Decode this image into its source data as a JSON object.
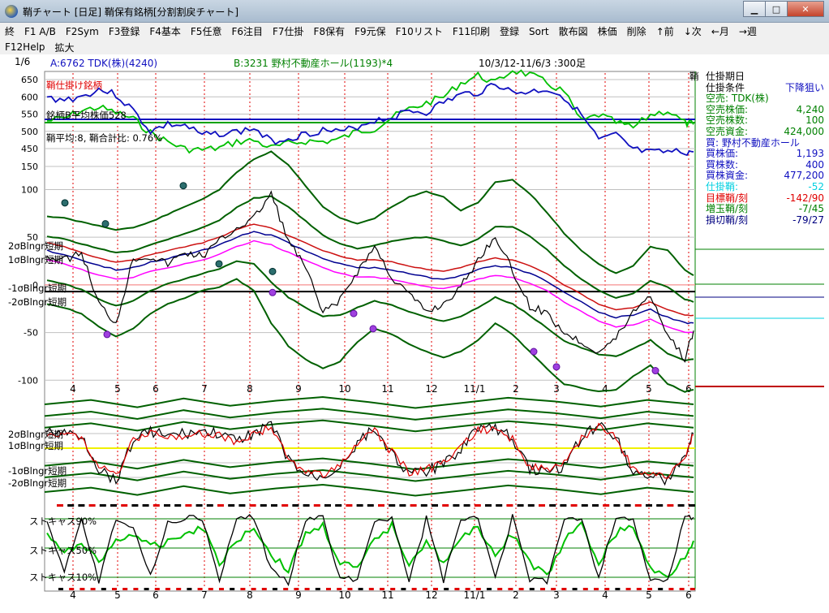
{
  "window": {
    "title": "鞘チャート  [日足]  鞘保有銘柄[分割割戻チャート]"
  },
  "menu": [
    "終",
    "F1 A/B",
    "F2Sym",
    "F3登録",
    "F4基本",
    "F5任意",
    "F6注目",
    "F7仕掛",
    "F8保有",
    "F9元保",
    "F10リスト",
    "F11印刷",
    "登録",
    "Sort",
    "散布図",
    "株価",
    "削除",
    "↑前",
    "↓次",
    "←月",
    "→週"
  ],
  "menu2": [
    "F12Help",
    "拡大"
  ],
  "info": {
    "page": "1/6",
    "stock_a": "A:6762 TDK(株)(4240)",
    "stock_b": "B:3231 野村不動産ホール(1193)*4",
    "period": "10/3/12-11/6/3 :300足"
  },
  "overlays": {
    "top_title": "鞘仕掛け銘柄",
    "avg_b": "銘柄B平均株価528",
    "avg_ratio": "鞘平均:8, 鞘合計比: 0.76%",
    "corner": "鞘"
  },
  "band_labels": {
    "p2": "2σBlngr短期",
    "p1": "1σBlngr短期",
    "m1": "-1σBlngr短期",
    "m2": "-2σBlngr短期"
  },
  "stoch_labels": {
    "s90": "ストキャス90%",
    "s50": "ストキャス50%",
    "s10": "ストキャス10%"
  },
  "x_months": [
    "4",
    "5",
    "6",
    "7",
    "8",
    "9",
    "10",
    "11",
    "12",
    "11/1",
    "2",
    "3",
    "4",
    "5",
    "6"
  ],
  "colors": {
    "stock_a": "#1010c0",
    "stock_b": "#00c000",
    "band": "#006000",
    "spread": "#000000",
    "ma_red": "#cc1010",
    "ma_pink": "#ff00ff",
    "ma_blue": "#000090",
    "zero_line": "#ff8080"
  },
  "chart_data": [
    {
      "type": "line",
      "name": "price",
      "yticks": [
        "650",
        "600",
        "550",
        "500",
        "450",
        "150"
      ],
      "ylim": [
        100,
        680
      ],
      "x": [
        0,
        8,
        16,
        24,
        32,
        40,
        48,
        56,
        64,
        72,
        80,
        88,
        96,
        104,
        112,
        120,
        128,
        136,
        144,
        152,
        160,
        168,
        176,
        184,
        192,
        200,
        208,
        216,
        224,
        232,
        240,
        248,
        256,
        264,
        272,
        280,
        288,
        296,
        300
      ],
      "series": [
        {
          "name": "A",
          "values": [
            596,
            592,
            600,
            622,
            606,
            560,
            500,
            520,
            516,
            488,
            494,
            498,
            508,
            470,
            480,
            492,
            504,
            496,
            514,
            532,
            540,
            560,
            555,
            584,
            606,
            612,
            640,
            612,
            614,
            622,
            600,
            546,
            474,
            488,
            432,
            376,
            390,
            384,
            396
          ]
        },
        {
          "name": "B",
          "values": [
            530,
            538,
            560,
            570,
            554,
            536,
            496,
            470,
            444,
            430,
            452,
            470,
            474,
            452,
            464,
            472,
            470,
            478,
            500,
            508,
            540,
            564,
            582,
            600,
            640,
            662,
            640,
            678,
            664,
            640,
            614,
            528,
            548,
            526,
            510,
            548,
            560,
            524,
            520
          ]
        }
      ]
    },
    {
      "type": "line",
      "name": "spread",
      "yticks": [
        "100",
        "50",
        "0",
        "-50",
        "-100"
      ],
      "ylim": [
        -110,
        120
      ],
      "x": [
        0,
        8,
        16,
        24,
        32,
        40,
        48,
        56,
        64,
        72,
        80,
        88,
        96,
        104,
        112,
        120,
        128,
        136,
        144,
        152,
        160,
        168,
        176,
        184,
        192,
        200,
        208,
        216,
        224,
        232,
        240,
        248,
        256,
        264,
        272,
        280,
        288,
        296,
        300
      ],
      "series": [
        {
          "name": "spread",
          "values": [
            30,
            26,
            34,
            -20,
            -40,
            28,
            30,
            22,
            34,
            30,
            46,
            60,
            70,
            96,
            46,
            18,
            -30,
            -16,
            14,
            40,
            8,
            -10,
            -28,
            -20,
            -2,
            26,
            52,
            14,
            -22,
            -30,
            -50,
            -60,
            -70,
            -56,
            -28,
            -10,
            -52,
            -78,
            -48
          ]
        },
        {
          "name": "ma",
          "values": [
            30,
            26,
            20,
            14,
            10,
            12,
            18,
            22,
            26,
            30,
            36,
            44,
            50,
            46,
            38,
            30,
            22,
            16,
            12,
            12,
            10,
            6,
            2,
            0,
            4,
            10,
            14,
            12,
            6,
            -2,
            -14,
            -24,
            -34,
            -40,
            -38,
            -32,
            -40,
            -46,
            -46
          ]
        },
        {
          "name": "upper2",
          "values": [
            72,
            70,
            66,
            62,
            58,
            60,
            66,
            74,
            82,
            90,
            100,
            118,
            132,
            140,
            126,
            104,
            82,
            70,
            64,
            70,
            82,
            92,
            98,
            92,
            78,
            86,
            108,
            110,
            96,
            76,
            54,
            36,
            22,
            12,
            20,
            40,
            36,
            16,
            10
          ]
        },
        {
          "name": "lower2",
          "values": [
            -20,
            -24,
            -30,
            -44,
            -54,
            -46,
            -30,
            -20,
            -14,
            -6,
            -2,
            6,
            -6,
            -40,
            -64,
            -78,
            -88,
            -80,
            -60,
            -46,
            -52,
            -62,
            -70,
            -76,
            -70,
            -58,
            -40,
            -52,
            -70,
            -88,
            -104,
            -108,
            -112,
            -110,
            -96,
            -84,
            -104,
            -112,
            -110
          ]
        }
      ]
    },
    {
      "type": "line",
      "name": "spread_norm",
      "x": [
        0,
        8,
        16,
        24,
        32,
        40,
        48,
        56,
        64,
        72,
        80,
        88,
        96,
        104,
        112,
        120,
        128,
        136,
        144,
        152,
        160,
        168,
        176,
        184,
        192,
        200,
        208,
        216,
        224,
        232,
        240,
        248,
        256,
        264,
        272,
        280,
        288,
        296,
        300
      ],
      "series": [
        {
          "name": "norm",
          "values": [
            1.2,
            1.0,
            0.9,
            -1.4,
            -2.2,
            0.6,
            1.2,
            0.8,
            1.0,
            1.1,
            1.0,
            0.4,
            1.1,
            1.6,
            -0.8,
            -1.9,
            -2.0,
            -1.2,
            0.4,
            1.3,
            -0.3,
            -1.8,
            -1.6,
            -1.1,
            0.0,
            1.5,
            1.3,
            0.7,
            -1.4,
            -1.7,
            -1.2,
            0.8,
            1.6,
            0.9,
            -1.7,
            -1.8,
            -2.2,
            -0.6,
            1.0
          ]
        }
      ]
    },
    {
      "type": "line",
      "name": "stochastic",
      "x": [
        0,
        8,
        16,
        24,
        32,
        40,
        48,
        56,
        64,
        72,
        80,
        88,
        96,
        104,
        112,
        120,
        128,
        136,
        144,
        152,
        160,
        168,
        176,
        184,
        192,
        200,
        208,
        216,
        224,
        232,
        240,
        248,
        256,
        264,
        272,
        280,
        288,
        296,
        300
      ],
      "series": [
        {
          "name": "fast",
          "values": [
            88,
            20,
            92,
            5,
            92,
            80,
            10,
            85,
            92,
            90,
            4,
            92,
            92,
            20,
            4,
            90,
            90,
            8,
            8,
            88,
            92,
            4,
            90,
            6,
            88,
            90,
            10,
            92,
            6,
            4,
            92,
            90,
            10,
            92,
            90,
            4,
            4,
            92,
            92
          ]
        },
        {
          "name": "slow",
          "values": [
            70,
            40,
            60,
            30,
            60,
            70,
            50,
            60,
            70,
            80,
            30,
            60,
            80,
            40,
            20,
            70,
            80,
            30,
            20,
            60,
            80,
            30,
            60,
            30,
            60,
            80,
            40,
            70,
            30,
            10,
            60,
            80,
            30,
            70,
            80,
            20,
            10,
            40,
            60
          ]
        }
      ]
    }
  ]
}
